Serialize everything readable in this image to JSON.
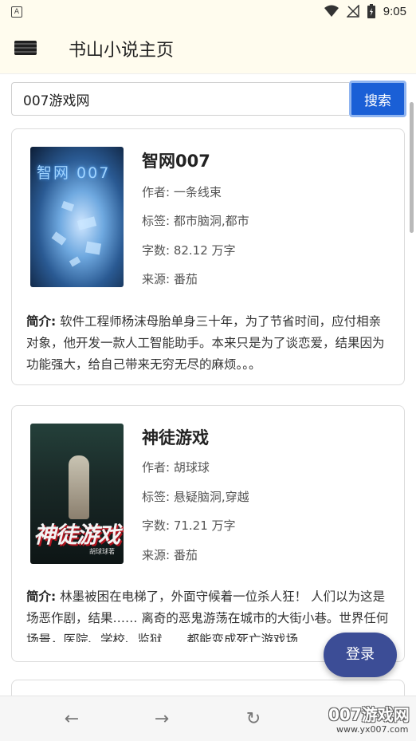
{
  "status_bar": {
    "time": "9:05",
    "app_indicator": "A"
  },
  "app_bar": {
    "title": "书山小说主页"
  },
  "search": {
    "value": "007游戏网",
    "button_label": "搜索"
  },
  "labels": {
    "author": "作者: ",
    "tags": "标签: ",
    "words": "字数: ",
    "source": "来源: ",
    "intro": "简介:"
  },
  "books": [
    {
      "cover_text": "智网 007",
      "title": "智网007",
      "author": "一条线束",
      "tags": "都市脑洞,都市",
      "words": "82.12 万字",
      "source": "番茄",
      "intro": "软件工程师杨沫母胎单身三十年，为了节省时间，应付相亲对象，他开发一款人工智能助手。本来只是为了谈恋爱，结果因为功能强大，给自己带来无穷无尽的麻烦。。。"
    },
    {
      "cover_text": "神徒游戏",
      "cover_sub": "胡球球著",
      "title": "神徒游戏",
      "author": "胡球球",
      "tags": "悬疑脑洞,穿越",
      "words": "71.21 万字",
      "source": "番茄",
      "intro": "林墨被困在电梯了，外面守候着一位杀人狂！ 人们以为这是场恶作剧，结果…… 离奇的恶鬼游荡在城市的大街小巷。世界任何场景，医院、学校、监狱……都能变成死亡游戏场"
    }
  ],
  "fab": {
    "label": "登录"
  },
  "bottom_nav": {
    "back_icon": "←",
    "forward_icon": "→",
    "refresh_icon": "↻"
  },
  "watermark": {
    "main": "007游戏网",
    "url": "www.yx007.com"
  },
  "colors": {
    "app_bar_bg": "#fffcee",
    "search_btn": "#1a5fd6",
    "fab": "#3c4d96"
  }
}
